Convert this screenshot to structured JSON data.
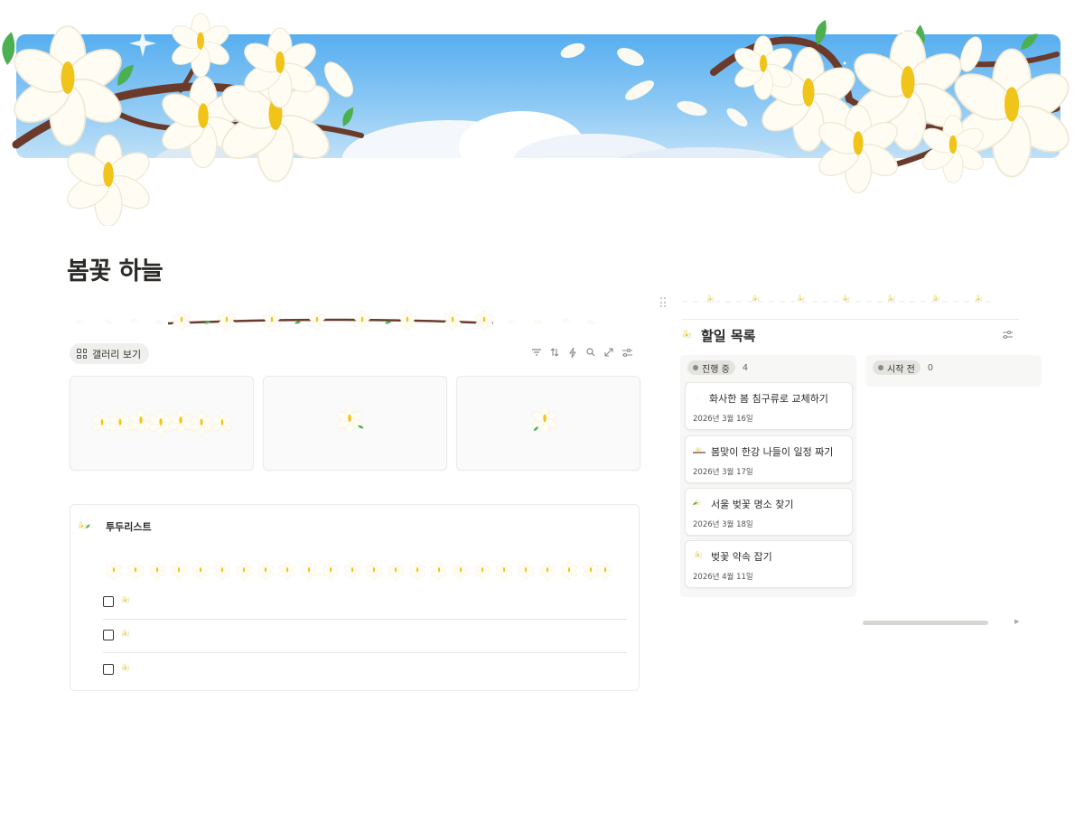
{
  "page": {
    "title": "봄꽃 하늘"
  },
  "cover": {
    "sky_color": "#57aef0",
    "flower": "magnolia-icon"
  },
  "gallery": {
    "view_tab_label": "갤러리 보기",
    "view_icon": "grid-icon",
    "toolbar_icons": [
      "filter-icon",
      "sort-icon",
      "automation-icon",
      "search-icon",
      "expand-icon",
      "settings-icon"
    ],
    "cards": [
      {},
      {},
      {}
    ]
  },
  "todo": {
    "title": "투두리스트",
    "items": [
      {
        "checked": false
      },
      {
        "checked": false
      },
      {
        "checked": false
      }
    ]
  },
  "board": {
    "title": "할일 목록",
    "columns": [
      {
        "status": "진행 중",
        "count": "4",
        "cards": [
          {
            "title": "화사한 봄 침구류로 교체하기",
            "date": "2026년 3월 16일"
          },
          {
            "title": "봄맞이 한강 나들이 일정 짜기",
            "date": "2026년 3월 17일"
          },
          {
            "title": "서울 벚꽃 명소 찾기",
            "date": "2026년 3월 18일"
          },
          {
            "title": "벚꽃 약속 잡기",
            "date": "2026년 4월 11일"
          }
        ]
      },
      {
        "status": "시작 전",
        "count": "0",
        "cards": []
      }
    ]
  },
  "colors": {
    "accent": "#f0c419",
    "branch": "#6b3a2a",
    "leaf": "#4caf50",
    "text": "#37352f"
  }
}
